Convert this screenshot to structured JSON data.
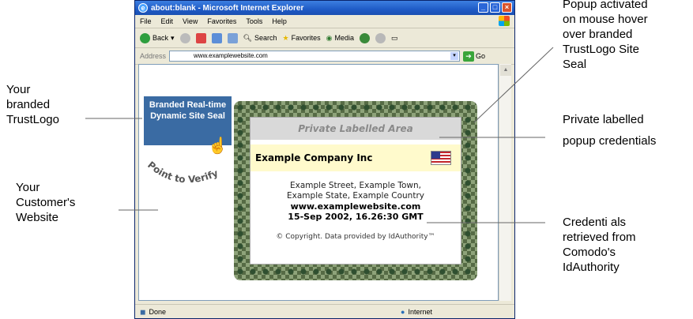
{
  "browser": {
    "title": "about:blank - Microsoft Internet Explorer",
    "menu": [
      "File",
      "Edit",
      "View",
      "Favorites",
      "Tools",
      "Help"
    ],
    "toolbar": {
      "back": "Back",
      "search": "Search",
      "favorites": "Favorites",
      "media": "Media"
    },
    "address_label": "Address",
    "address_value": "www.examplewebsite.com",
    "go": "Go",
    "status": "Done",
    "zone": "Internet"
  },
  "page": {
    "seal_text": "Branded Real-time Dynamic Site Seal",
    "point_to_verify": "Point to Verify",
    "popup": {
      "header": "Private Labelled Area",
      "company": "Example Company Inc",
      "address_line1": "Example Street, Example Town,",
      "address_line2": "Example State, Example Country",
      "website": "www.examplewebsite.com",
      "timestamp": "15-Sep 2002, 16.26:30 GMT",
      "copyright": "© Copyright. Data provided by IdAuthority™"
    }
  },
  "annotations": {
    "trustlogo": [
      "Your",
      "branded",
      "TrustLogo"
    ],
    "website": [
      "Your",
      "Customer's",
      "Website"
    ],
    "popup_activated": [
      "Popup activated",
      "on mouse hover",
      "over branded",
      "TrustLogo Site",
      "Seal"
    ],
    "private_label": [
      "Private labelled",
      "popup credentials"
    ],
    "credentials": [
      "Credenti als",
      "retrieved from",
      "Comodo's",
      "IdAuthority"
    ]
  }
}
